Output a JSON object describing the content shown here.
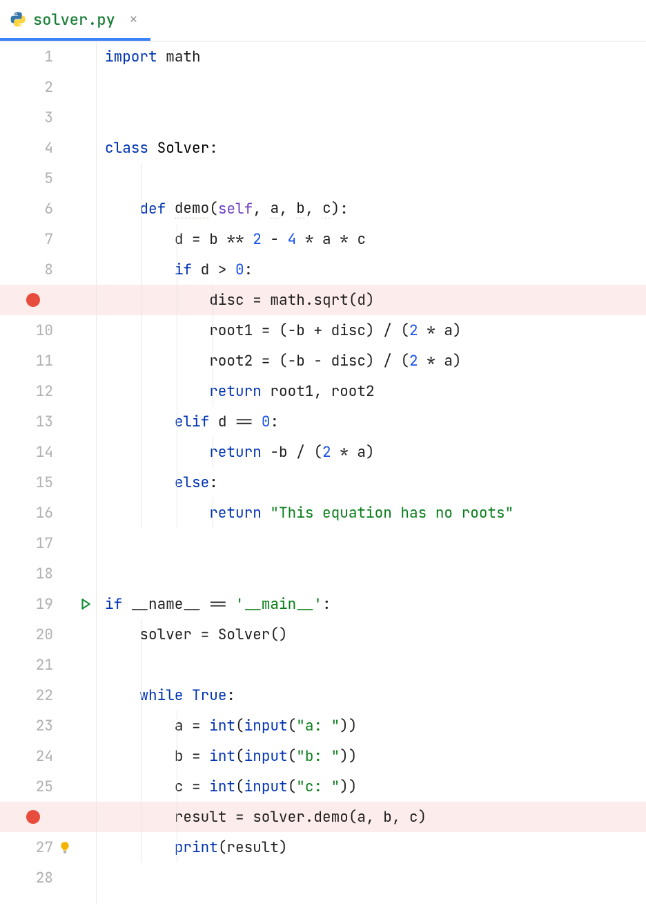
{
  "tab": {
    "filename": "solver.py",
    "close_glyph": "×"
  },
  "gutter": {
    "lines": [
      "1",
      "2",
      "3",
      "4",
      "5",
      "6",
      "7",
      "8",
      "",
      "10",
      "11",
      "12",
      "13",
      "14",
      "15",
      "16",
      "17",
      "18",
      "19",
      "20",
      "21",
      "22",
      "23",
      "24",
      "25",
      "",
      "27",
      "28"
    ],
    "breakpoints": [
      9,
      26
    ],
    "run_line": 19,
    "bulb_line": 27
  },
  "code": {
    "l1": {
      "import": "import",
      "math": "math"
    },
    "l4": {
      "class_kw": "class",
      "cls": "Solver",
      "colon": ":"
    },
    "l6": {
      "def_kw": "def",
      "name": "demo",
      "open": "(",
      "self": "self",
      "sep1": ", ",
      "a": "a",
      "sep2": ", ",
      "b": "b",
      "sep3": ", ",
      "c": "c",
      "close": "):"
    },
    "l7": {
      "body": "d = b ** ",
      "n2": "2",
      "mid": " - ",
      "n4": "4",
      "rest": " * a * c"
    },
    "l8": {
      "if_kw": "if",
      "cond": " d > ",
      "zero": "0",
      "colon": ":"
    },
    "l9": {
      "body": "disc = math.sqrt(d)"
    },
    "l10": {
      "pre": "root1 = (-b + disc) / (",
      "two": "2",
      "post": " * a)"
    },
    "l11": {
      "pre": "root2 = (-b - disc) / (",
      "two": "2",
      "post": " * a)"
    },
    "l12": {
      "ret": "return",
      "rest": " root1, root2"
    },
    "l13": {
      "elif_kw": "elif",
      "cond": " d == ",
      "zero": "0",
      "colon": ":"
    },
    "l14": {
      "ret": "return",
      "mid": " -b / (",
      "two": "2",
      "post": " * a)"
    },
    "l15": {
      "else_kw": "else",
      "colon": ":"
    },
    "l16": {
      "ret": "return",
      "sp": " ",
      "str": "\"This equation has no roots\""
    },
    "l19": {
      "if_kw": "if",
      "sp": " ",
      "name": "__name__",
      "eq": " == ",
      "main": "'__main__'",
      "colon": ":"
    },
    "l20": {
      "body": "solver = Solver()"
    },
    "l22": {
      "while_kw": "while",
      "sp": " ",
      "true_kw": "True",
      "colon": ":"
    },
    "l23": {
      "pre": "a = ",
      "int": "int",
      "mid": "(",
      "input": "input",
      "paren": "(",
      "str": "\"a: \"",
      "close": "))"
    },
    "l24": {
      "pre": "b = ",
      "int": "int",
      "mid": "(",
      "input": "input",
      "paren": "(",
      "str": "\"b: \"",
      "close": "))"
    },
    "l25": {
      "pre": "c = ",
      "int": "int",
      "mid": "(",
      "input": "input",
      "paren": "(",
      "str": "\"c: \"",
      "close": "))"
    },
    "l26": {
      "body": "result = solver.demo(a, b, c)"
    },
    "l27": {
      "print": "print",
      "rest": "(result)"
    }
  }
}
